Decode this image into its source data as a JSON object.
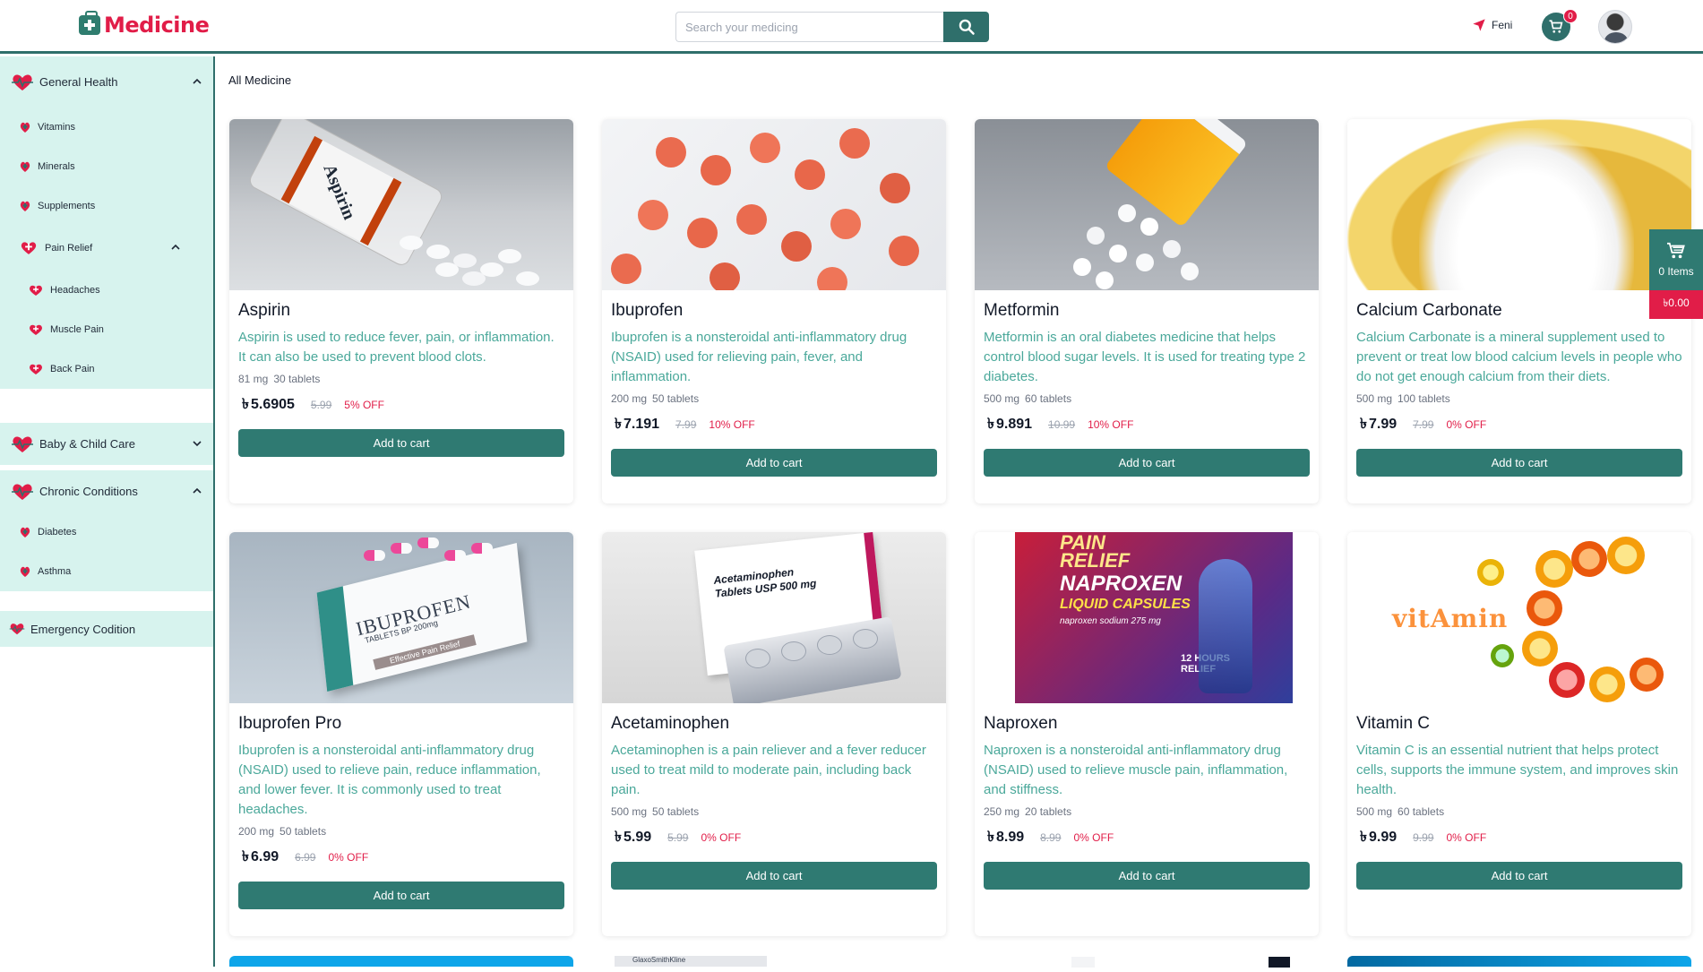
{
  "brand": {
    "name": "Medicine"
  },
  "search": {
    "placeholder": "Search your medicing"
  },
  "location": {
    "label": "Feni"
  },
  "cart": {
    "count": "0",
    "floating_items": "0 Items",
    "floating_total": "৳0.00"
  },
  "main": {
    "title": "All Medicine"
  },
  "sidebar": {
    "groups": [
      {
        "label": "General Health",
        "items": [
          "Vitamins",
          "Minerals",
          "Supplements"
        ],
        "sub": {
          "label": "Pain Relief",
          "items": [
            "Headaches",
            "Muscle Pain",
            "Back Pain"
          ]
        }
      },
      {
        "label": "Baby & Child Care"
      },
      {
        "label": "Chronic Conditions",
        "items": [
          "Diabetes",
          "Asthma"
        ]
      },
      {
        "label": "Emergency Codition"
      }
    ]
  },
  "currency": "৳",
  "add_to_cart_label": "Add to cart",
  "products": [
    {
      "name": "Aspirin",
      "desc": "Aspirin is used to reduce fever, pain, or inflammation. It can also be used to prevent blood clots.",
      "strength": "81 mg",
      "pack": "30 tablets",
      "price": "5.6905",
      "old_price": "5.99",
      "discount": "5% OFF"
    },
    {
      "name": "Ibuprofen",
      "desc": "Ibuprofen is a nonsteroidal anti-inflammatory drug (NSAID) used for relieving pain, fever, and inflammation.",
      "strength": "200 mg",
      "pack": "50 tablets",
      "price": "7.191",
      "old_price": "7.99",
      "discount": "10% OFF"
    },
    {
      "name": "Metformin",
      "desc": "Metformin is an oral diabetes medicine that helps control blood sugar levels. It is used for treating type 2 diabetes.",
      "strength": "500 mg",
      "pack": "60 tablets",
      "price": "9.891",
      "old_price": "10.99",
      "discount": "10% OFF"
    },
    {
      "name": "Calcium Carbonate",
      "desc": "Calcium Carbonate is a mineral supplement used to prevent or treat low blood calcium levels in people who do not get enough calcium from their diets.",
      "strength": "500 mg",
      "pack": "100 tablets",
      "price": "7.99",
      "old_price": "7.99",
      "discount": "0% OFF"
    },
    {
      "name": "Ibuprofen Pro",
      "desc": "Ibuprofen is a nonsteroidal anti-inflammatory drug (NSAID) used to relieve pain, reduce inflammation, and lower fever. It is commonly used to treat headaches.",
      "strength": "200 mg",
      "pack": "50 tablets",
      "price": "6.99",
      "old_price": "6.99",
      "discount": "0% OFF"
    },
    {
      "name": "Acetaminophen",
      "desc": "Acetaminophen is a pain reliever and a fever reducer used to treat mild to moderate pain, including back pain.",
      "strength": "500 mg",
      "pack": "50 tablets",
      "price": "5.99",
      "old_price": "5.99",
      "discount": "0% OFF"
    },
    {
      "name": "Naproxen",
      "desc": "Naproxen is a nonsteroidal anti-inflammatory drug (NSAID) used to relieve muscle pain, inflammation, and stiffness.",
      "strength": "250 mg",
      "pack": "20 tablets",
      "price": "8.99",
      "old_price": "8.99",
      "discount": "0% OFF"
    },
    {
      "name": "Vitamin C",
      "desc": "Vitamin C is an essential nutrient that helps protect cells, supports the immune system, and improves skin health.",
      "strength": "500 mg",
      "pack": "60 tablets",
      "price": "9.99",
      "old_price": "9.99",
      "discount": "0% OFF"
    }
  ],
  "image_labels": {
    "aspirin_bottle": "Aspirin",
    "ibuprofen_box": "IBUPROFEN",
    "ibuprofen_box_sub": "TABLETS BP 200mg",
    "ibuprofen_box_band": "Effective Pain Relief",
    "acet_box": "Acetaminophen Tablets USP 500 mg",
    "naproxen_top": "PAIN RELIEF",
    "naproxen_name": "NAPROXEN",
    "naproxen_sub": "LIQUID CAPSULES",
    "naproxen_dose": "naproxen sodium 275 mg",
    "naproxen_hours": "12 HOURS RELIEF",
    "vitamin_word": "vitAmin",
    "peek_label": "GlaxoSmithKline"
  },
  "colors": {
    "primary": "#2f6f6b",
    "accent": "#e11d48",
    "sidebar_bg": "#d7f3ee",
    "desc": "#4aa89a"
  },
  "icons": [
    "search-icon",
    "location-arrow-icon",
    "cart-icon",
    "chevron-up-icon",
    "chevron-down-icon",
    "heart-pulse-icon",
    "medical-heart-icon"
  ]
}
